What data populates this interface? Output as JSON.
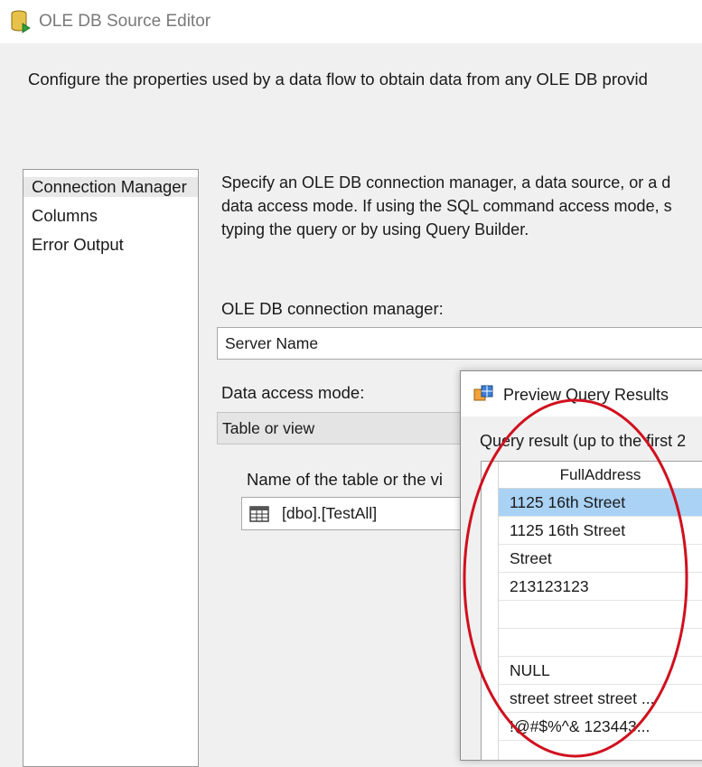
{
  "window": {
    "title": "OLE DB Source Editor"
  },
  "description": "Configure the properties used by a data flow to obtain data from any OLE DB provid",
  "nav": {
    "items": [
      {
        "label": "Connection Manager",
        "selected": true
      },
      {
        "label": "Columns",
        "selected": false
      },
      {
        "label": "Error Output",
        "selected": false
      }
    ]
  },
  "instructions": {
    "line1": "Specify an OLE DB connection manager, a data source, or a d",
    "line2": "data access mode. If using the SQL command access mode, s",
    "line3": "typing the query or by using Query Builder."
  },
  "connection": {
    "label": "OLE DB connection manager:",
    "value": "Server Name"
  },
  "access_mode": {
    "label": "Data access mode:",
    "value": "Table or view"
  },
  "table": {
    "label": "Name of the table or the vi",
    "value": "[dbo].[TestAll]",
    "icon": "table-icon"
  },
  "preview": {
    "title": "Preview Query Results",
    "note": "Query result (up to the first 2",
    "column_header": "FullAddress",
    "rows": [
      {
        "value": "1125 16th Street",
        "selected": true
      },
      {
        "value": "1125 16th Street",
        "selected": false
      },
      {
        "value": "Street",
        "selected": false
      },
      {
        "value": "213123123",
        "selected": false
      },
      {
        "value": "",
        "selected": false
      },
      {
        "value": "",
        "selected": false
      },
      {
        "value": "NULL",
        "selected": false
      },
      {
        "value": "street street street ...",
        "selected": false
      },
      {
        "value": "!@#$%^& 123443...",
        "selected": false
      }
    ]
  },
  "colors": {
    "selection": "#a9d2f5",
    "annotation": "#d0101e"
  }
}
